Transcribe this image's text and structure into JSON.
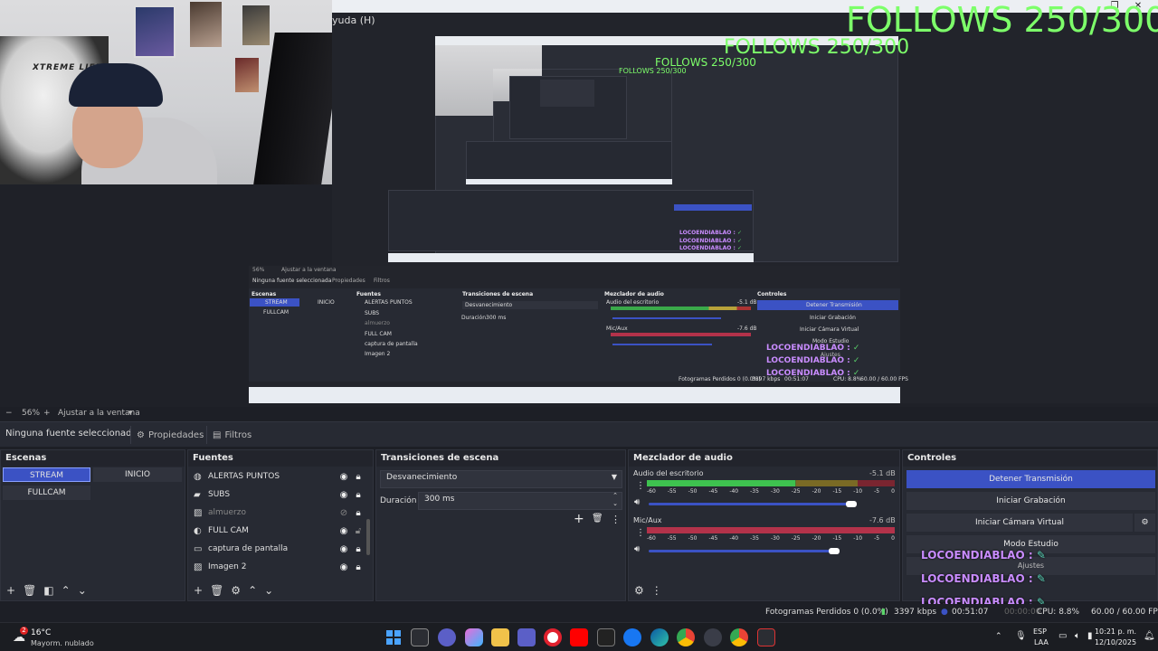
{
  "preview": {
    "window_title_fragment": "yuda (H)",
    "follows": "FOLLOWS 250/300",
    "webcam_chair_text": "XTREME LIFE",
    "mini_labels": {
      "no_source": "Ninguna fuente seleccionada",
      "properties": "Propiedades",
      "filters": "Filtros",
      "scenes": "Escenas",
      "sources": "Fuentes",
      "transitions": "Transiciones de escena",
      "mixer": "Mezclador de audio",
      "controls": "Controles",
      "stream": "STREAM",
      "inicio": "INICIO",
      "fullcam": "FULLCAM",
      "src1": "ALERTAS PUNTOS",
      "src2": "SUBS",
      "src3": "almuerzo",
      "src4": "FULL CAM",
      "src5": "captura de pantalla",
      "src6": "Imagen 2",
      "fade": "Desvanecimiento",
      "duration": "Duración",
      "duration_val": "300 ms",
      "desktop": "Audio del escritorio",
      "mic": "Mic/Aux",
      "stop": "Detener Transmisión",
      "rec": "Iniciar Grabación",
      "vcam": "Iniciar Cámara Virtual",
      "studio": "Modo Estudio",
      "settings": "Ajustes",
      "status": "Fotogramas Perdidos 0 (0.0%)",
      "kbps": "3397 kbps",
      "time": "00:51:07",
      "cpu": "CPU: 8.8%",
      "fps": "60.00 / 60.00 FPS",
      "zoom": "56%",
      "fit": "Ajustar a la ventana",
      "db1": "-5.1 dB",
      "db2": "-7.6 dB"
    },
    "loco_name": "LOCOENDIABLAO",
    "loco_sep": ":"
  },
  "zoombar": {
    "minus": "−",
    "zoom": "56%",
    "plus": "+",
    "fit": "Ajustar a la ventana",
    "dropdown": "▾"
  },
  "source_toolbar": {
    "no_source": "Ninguna fuente seleccionad",
    "properties": "Propiedades",
    "filters": "Filtros"
  },
  "scenes": {
    "title": "Escenas",
    "items": [
      "STREAM",
      "INICIO",
      "FULLCAM"
    ],
    "active": "STREAM"
  },
  "sources": {
    "title": "Fuentes",
    "items": [
      {
        "icon": "globe-icon",
        "name": "ALERTAS PUNTOS",
        "visible": true
      },
      {
        "icon": "folder-icon",
        "name": "SUBS",
        "visible": true
      },
      {
        "icon": "image-icon",
        "name": "almuerzo",
        "visible": false
      },
      {
        "icon": "camera-icon",
        "name": "FULL CAM",
        "visible": true
      },
      {
        "icon": "monitor-icon",
        "name": "captura de pantalla",
        "visible": true
      },
      {
        "icon": "image-icon",
        "name": "Imagen 2",
        "visible": true
      }
    ]
  },
  "transitions": {
    "title": "Transiciones de escena",
    "selected": "Desvanecimiento",
    "duration_label": "Duración",
    "duration_value": "300 ms"
  },
  "mixer": {
    "title": "Mezclador de audio",
    "channels": [
      {
        "name": "Audio del escritorio",
        "db": "-5.1 dB",
        "volume": 0.83,
        "level": 0.6
      },
      {
        "name": "Mic/Aux",
        "db": "-7.6 dB",
        "volume": 0.76,
        "level": 0.0
      }
    ],
    "scale": [
      "-60",
      "-55",
      "-50",
      "-45",
      "-40",
      "-35",
      "-30",
      "-25",
      "-20",
      "-15",
      "-10",
      "-5",
      "0"
    ]
  },
  "controls": {
    "title": "Controles",
    "stop_stream": "Detener Transmisión",
    "start_recording": "Iniciar Grabación",
    "start_virtual_cam": "Iniciar Cámara Virtual",
    "studio_mode": "Modo Estudio",
    "settings": "Ajustes"
  },
  "overlay": {
    "loco_name": "LOCOENDIABLAO",
    "sep": ":"
  },
  "status": {
    "dropped": "Fotogramas Perdidos 0 (0.0%)",
    "kbps": "3397 kbps",
    "live_time": "00:51:07",
    "rec_time": "00:00:00",
    "cpu": "CPU: 8.8%",
    "fps": "60.00 / 60.00 FPS"
  },
  "taskbar": {
    "weather_badge": "2",
    "temp": "16°C",
    "condition": "Mayorm. nublado",
    "lang1": "ESP",
    "lang2": "LAA",
    "time": "10:21 p. m.",
    "date": "12/10/2025"
  },
  "colors": {
    "accent": "#3b52c4",
    "follows": "#7dff6a",
    "loco": "#c98cff"
  }
}
